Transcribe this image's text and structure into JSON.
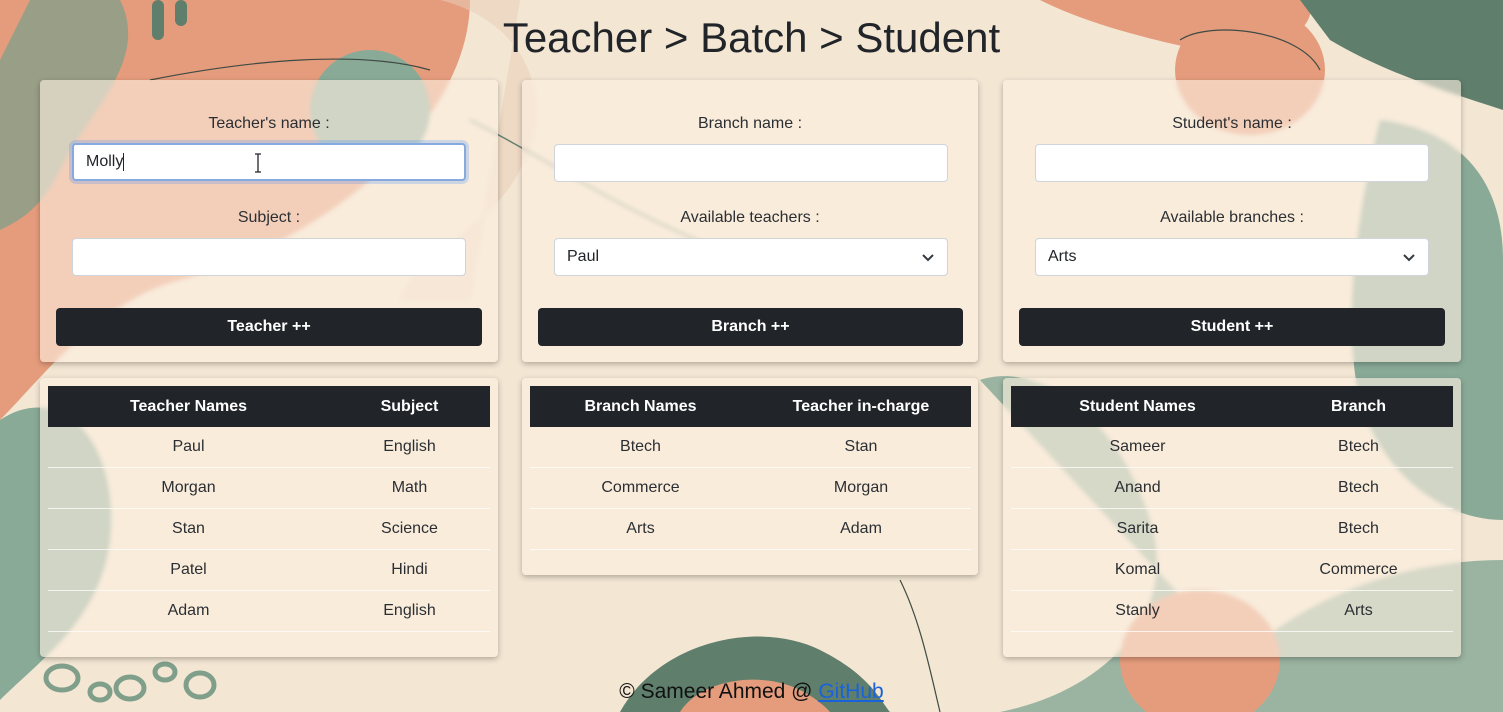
{
  "page_title": "Teacher > Batch > Student",
  "teacher_form": {
    "name_label": "Teacher's name :",
    "name_value": "Molly",
    "subject_label": "Subject :",
    "subject_value": "",
    "button_label": "Teacher ++"
  },
  "branch_form": {
    "name_label": "Branch name :",
    "name_value": "",
    "teachers_label": "Available teachers :",
    "teachers_selected": "Paul",
    "button_label": "Branch ++"
  },
  "student_form": {
    "name_label": "Student's name :",
    "name_value": "",
    "branches_label": "Available branches :",
    "branches_selected": "Arts",
    "button_label": "Student ++"
  },
  "teacher_table": {
    "headers": [
      "Teacher Names",
      "Subject"
    ],
    "rows": [
      [
        "Paul",
        "English"
      ],
      [
        "Morgan",
        "Math"
      ],
      [
        "Stan",
        "Science"
      ],
      [
        "Patel",
        "Hindi"
      ],
      [
        "Adam",
        "English"
      ]
    ]
  },
  "branch_table": {
    "headers": [
      "Branch Names",
      "Teacher in-charge"
    ],
    "rows": [
      [
        "Btech",
        "Stan"
      ],
      [
        "Commerce",
        "Morgan"
      ],
      [
        "Arts",
        "Adam"
      ]
    ]
  },
  "student_table": {
    "headers": [
      "Student Names",
      "Branch"
    ],
    "rows": [
      [
        "Sameer",
        "Btech"
      ],
      [
        "Anand",
        "Btech"
      ],
      [
        "Sarita",
        "Btech"
      ],
      [
        "Komal",
        "Commerce"
      ],
      [
        "Stanly",
        "Arts"
      ]
    ]
  },
  "footer": {
    "text": "© Sameer Ahmed @ ",
    "link": "GitHub"
  },
  "colors": {
    "button_bg": "#212529",
    "header_bg": "#212529",
    "link": "#1a62d9",
    "bg_cream": "#f3e6d3",
    "bg_sage": "#8aaa98",
    "bg_terracotta": "#e59c7c"
  }
}
